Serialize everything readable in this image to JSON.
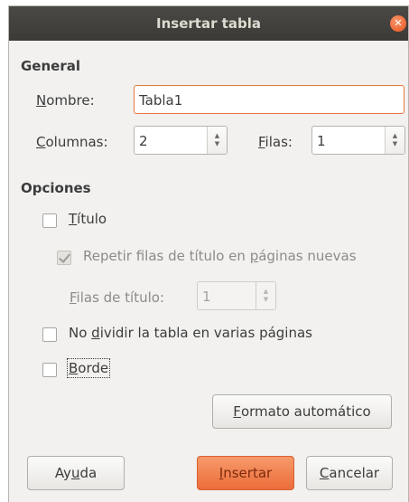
{
  "window": {
    "title": "Insertar tabla"
  },
  "general": {
    "heading": "General",
    "name_label_u": "N",
    "name_label_rest": "ombre:",
    "name_value": "Tabla1",
    "columns_label_u": "C",
    "columns_label_rest": "olumnas:",
    "columns_value": "2",
    "rows_label_u": "F",
    "rows_label_rest": "ilas:",
    "rows_value": "1"
  },
  "options": {
    "heading": "Opciones",
    "heading_row_label_u": "T",
    "heading_row_label_rest": "ítulo",
    "repeat_pre": "Repetir filas de título en ",
    "repeat_u": "p",
    "repeat_post": "áginas nuevas",
    "heading_rows_label_u": "F",
    "heading_rows_label_rest": "ilas de título:",
    "heading_rows_value": "1",
    "dont_split_pre": "No ",
    "dont_split_u": "d",
    "dont_split_post": "ividir la tabla en varias páginas",
    "border_label_u": "B",
    "border_label_rest": "orde"
  },
  "buttons": {
    "autoformat_u": "F",
    "autoformat_rest": "ormato automático",
    "help_pre": "Ay",
    "help_u": "u",
    "help_post": "da",
    "insert_u": "I",
    "insert_rest": "nsertar",
    "cancel_u": "C",
    "cancel_rest": "ancelar"
  },
  "colors": {
    "accent": "#ec6d3a",
    "titlebar": "#403f3b",
    "background": "#f2f1f0"
  }
}
